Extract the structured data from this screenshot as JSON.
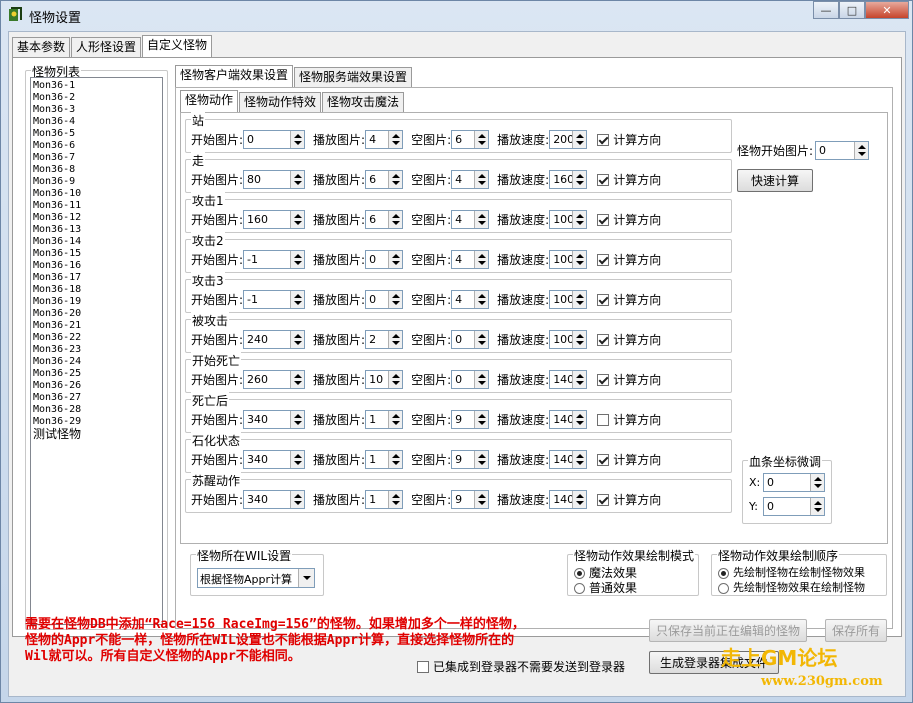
{
  "window": {
    "title": "怪物设置",
    "minimize": "—",
    "maximize": "□",
    "close": "✕"
  },
  "tabs": [
    "基本参数",
    "人形怪设置",
    "自定义怪物"
  ],
  "monster_list": {
    "title": "怪物列表",
    "items": [
      "Mon36-1",
      "Mon36-2",
      "Mon36-3",
      "Mon36-4",
      "Mon36-5",
      "Mon36-6",
      "Mon36-7",
      "Mon36-8",
      "Mon36-9",
      "Mon36-10",
      "Mon36-11",
      "Mon36-12",
      "Mon36-13",
      "Mon36-14",
      "Mon36-15",
      "Mon36-16",
      "Mon36-17",
      "Mon36-18",
      "Mon36-19",
      "Mon36-20",
      "Mon36-21",
      "Mon36-22",
      "Mon36-23",
      "Mon36-24",
      "Mon36-25",
      "Mon36-26",
      "Mon36-27",
      "Mon36-28",
      "Mon36-29",
      "测试怪物"
    ]
  },
  "subtabs": [
    "怪物客户端效果设置",
    "怪物服务端效果设置"
  ],
  "subsubtabs": [
    "怪物动作",
    "怪物动作特效",
    "怪物攻击魔法"
  ],
  "field_labels": {
    "start": "开始图片:",
    "play": "播放图片:",
    "empty": "空图片:",
    "speed": "播放速度:",
    "dir": "计算方向"
  },
  "actions": [
    {
      "name": "站",
      "start": "0",
      "play": "4",
      "empty": "6",
      "speed": "200",
      "dir": true
    },
    {
      "name": "走",
      "start": "80",
      "play": "6",
      "empty": "4",
      "speed": "160",
      "dir": true
    },
    {
      "name": "攻击1",
      "start": "160",
      "play": "6",
      "empty": "4",
      "speed": "100",
      "dir": true
    },
    {
      "name": "攻击2",
      "start": "-1",
      "play": "0",
      "empty": "4",
      "speed": "100",
      "dir": true
    },
    {
      "name": "攻击3",
      "start": "-1",
      "play": "0",
      "empty": "4",
      "speed": "100",
      "dir": true
    },
    {
      "name": "被攻击",
      "start": "240",
      "play": "2",
      "empty": "0",
      "speed": "100",
      "dir": true
    },
    {
      "name": "开始死亡",
      "start": "260",
      "play": "10",
      "empty": "0",
      "speed": "140",
      "dir": true
    },
    {
      "name": "死亡后",
      "start": "340",
      "play": "1",
      "empty": "9",
      "speed": "140",
      "dir": false
    },
    {
      "name": "石化状态",
      "start": "340",
      "play": "1",
      "empty": "9",
      "speed": "140",
      "dir": true
    },
    {
      "name": "苏醒动作",
      "start": "340",
      "play": "1",
      "empty": "9",
      "speed": "140",
      "dir": true
    }
  ],
  "monster_start": {
    "label": "怪物开始图片:",
    "value": "0"
  },
  "quick_calc": "快速计算",
  "hpbar": {
    "title": "血条坐标微调",
    "x_label": "X:",
    "x": "0",
    "y_label": "Y:",
    "y": "0"
  },
  "wil": {
    "title": "怪物所在WIL设置",
    "selected": "根据怪物Appr计算"
  },
  "draw_mode": {
    "title": "怪物动作效果绘制模式",
    "options": [
      "魔法效果",
      "普通效果"
    ],
    "selected": 0
  },
  "draw_order": {
    "title": "怪物动作效果绘制顺序",
    "options": [
      "先绘制怪物在绘制怪物效果",
      "先绘制怪物效果在绘制怪物"
    ],
    "selected": 0
  },
  "note": "需要在怪物DB中添加“Race=156 RaceImg=156”的怪物。如果增加多个一样的怪物，\n怪物的Appr不能一样，怪物所在WIL设置也不能根据Appr计算，直接选择怪物所在的\nWil就可以。所有自定义怪物的Appr不能相同。",
  "buttons": {
    "save_current": "只保存当前正在编辑的怪物",
    "save_all": "保存所有",
    "gen": "生成登录器集成文件"
  },
  "integrated": {
    "label": "已集成到登录器不需要发送到登录器",
    "checked": false
  },
  "watermark": {
    "line1": "走上GM论坛",
    "line2": "www.230gm.com"
  },
  "colors": {
    "note": "#e00000",
    "watermark": "#f2b705"
  }
}
